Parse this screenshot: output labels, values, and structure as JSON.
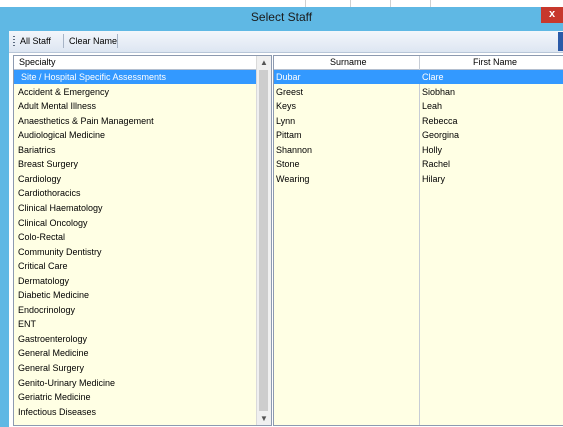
{
  "window": {
    "title": "Select Staff",
    "close_label": "x"
  },
  "toolbar": {
    "all_staff": "All Staff",
    "clear_name": "Clear Name"
  },
  "specialty_list": {
    "header": "Specialty",
    "items": [
      "Site / Hospital Specific Assessments",
      "Accident & Emergency",
      "Adult Mental Illness",
      "Anaesthetics & Pain Management",
      "Audiological Medicine",
      "Bariatrics",
      "Breast Surgery",
      "Cardiology",
      "Cardiothoracics",
      "Clinical Haematology",
      "Clinical Oncology",
      "Colo-Rectal",
      "Community Dentistry",
      "Critical Care",
      "Dermatology",
      "Diabetic Medicine",
      "Endocrinology",
      "ENT",
      "Gastroenterology",
      "General Medicine",
      "General Surgery",
      "Genito-Urinary Medicine",
      "Geriatric Medicine",
      "Infectious Diseases"
    ],
    "selected_index": 0
  },
  "staff_table": {
    "columns": [
      "Surname",
      "First Name"
    ],
    "rows": [
      [
        "Dubar",
        "Clare"
      ],
      [
        "Greest",
        "Siobhan"
      ],
      [
        "Keys",
        "Leah"
      ],
      [
        "Lynn",
        "Rebecca"
      ],
      [
        "Pittam",
        "Georgina"
      ],
      [
        "Shannon",
        "Holly"
      ],
      [
        "Stone",
        "Rachel"
      ],
      [
        "Wearing",
        "Hilary"
      ]
    ],
    "selected_index": 0
  },
  "colors": {
    "selection": "#3399ff",
    "list_background": "#ffffe4",
    "titlebar": "#5fb8e4",
    "close": "#c7382c"
  }
}
